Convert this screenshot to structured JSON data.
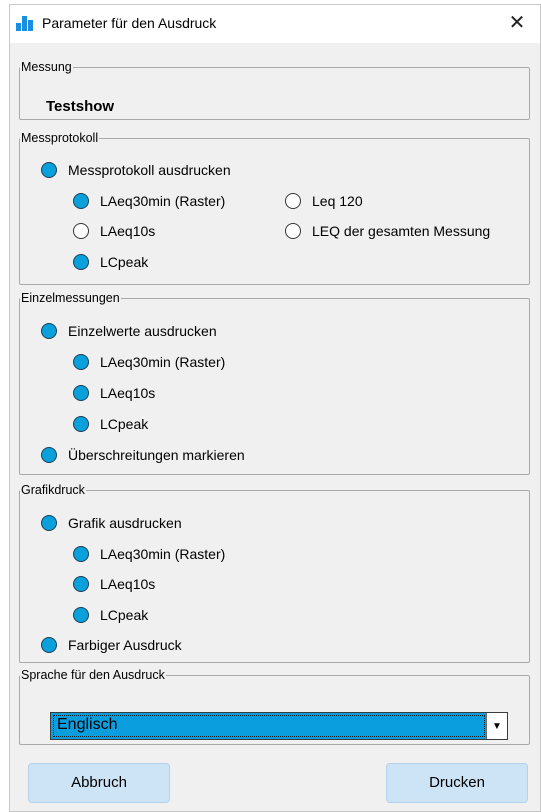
{
  "window": {
    "title": "Parameter für den Ausdruck",
    "close_glyph": "✕",
    "icon": "bar-chart-icon"
  },
  "messung": {
    "legend": "Messung",
    "value": "Testshow"
  },
  "messprotokoll": {
    "legend": "Messprotokoll",
    "main": {
      "label": "Messprotokoll ausdrucken",
      "checked": true
    },
    "options": [
      {
        "label": "LAeq30min (Raster)",
        "checked": true
      },
      {
        "label": "LAeq10s",
        "checked": false
      },
      {
        "label": "LCpeak",
        "checked": true
      },
      {
        "label": "Leq 120",
        "checked": false
      },
      {
        "label": "LEQ der gesamten Messung",
        "checked": false
      }
    ]
  },
  "einzelmessungen": {
    "legend": "Einzelmessungen",
    "main": {
      "label": "Einzelwerte ausdrucken",
      "checked": true
    },
    "options": [
      {
        "label": "LAeq30min (Raster)",
        "checked": true
      },
      {
        "label": "LAeq10s",
        "checked": true
      },
      {
        "label": "LCpeak",
        "checked": true
      }
    ],
    "mark": {
      "label": "Überschreitungen markieren",
      "checked": true
    }
  },
  "grafikdruck": {
    "legend": "Grafikdruck",
    "main": {
      "label": "Grafik ausdrucken",
      "checked": true
    },
    "options": [
      {
        "label": "LAeq30min (Raster)",
        "checked": true
      },
      {
        "label": "LAeq10s",
        "checked": true
      },
      {
        "label": "LCpeak",
        "checked": true
      }
    ],
    "color": {
      "label": "Farbiger Ausdruck",
      "checked": true
    }
  },
  "sprache": {
    "legend": "Sprache für den Ausdruck",
    "selected": "Englisch"
  },
  "buttons": {
    "cancel": "Abbruch",
    "print": "Drucken"
  },
  "colors": {
    "accent": "#0aa0dc",
    "button": "#cde4f7",
    "dialog": "#f0f0f0"
  }
}
